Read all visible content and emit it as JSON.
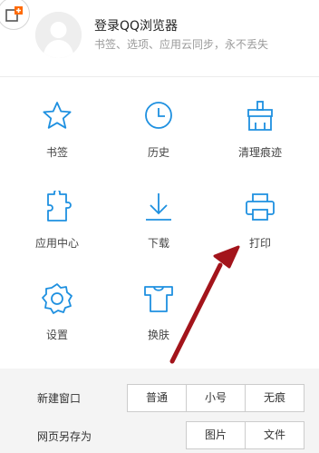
{
  "header": {
    "login_title": "登录QQ浏览器",
    "login_subtitle": "书签、选项、应用云同步，永不丢失"
  },
  "grid": [
    {
      "label": "书签",
      "icon": "star-icon"
    },
    {
      "label": "历史",
      "icon": "clock-icon"
    },
    {
      "label": "清理痕迹",
      "icon": "broom-icon"
    },
    {
      "label": "应用中心",
      "icon": "puzzle-icon"
    },
    {
      "label": "下载",
      "icon": "download-icon"
    },
    {
      "label": "打印",
      "icon": "printer-icon"
    },
    {
      "label": "设置",
      "icon": "gear-icon"
    },
    {
      "label": "换肤",
      "icon": "tshirt-icon"
    }
  ],
  "new_window": {
    "label": "新建窗口",
    "options": [
      "普通",
      "小号",
      "无痕"
    ]
  },
  "save_page": {
    "label": "网页另存为",
    "options": [
      "图片",
      "文件"
    ]
  },
  "colors": {
    "accent": "#1e90e0",
    "badge": "#ff6a00",
    "annotation_arrow": "#a3141b"
  }
}
